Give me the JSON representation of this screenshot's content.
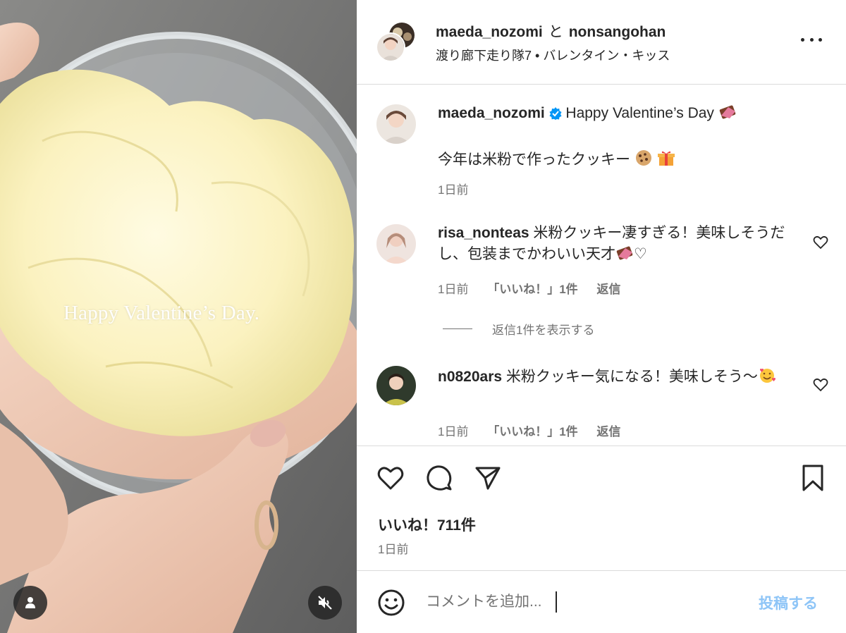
{
  "media": {
    "overlay_text": "Happy Valentine’s Day.",
    "icons": {
      "tags": "person-icon",
      "mute": "speaker-muted-icon"
    }
  },
  "header": {
    "user1": "maeda_nozomi",
    "conjunction": "と",
    "user2": "nonsangohan",
    "subtitle": "渡り廊下走り隊7 • バレンタイン・キッス",
    "more_icon": "ellipsis-icon"
  },
  "caption": {
    "username": "maeda_nozomi",
    "verified_icon": "verified-badge-icon",
    "line1": "Happy Valentine’s Day",
    "line2": "今年は米粉で作ったクッキー",
    "emoji": [
      "chocolate-emoji",
      "cookie-emoji",
      "gift-emoji"
    ],
    "time": "1日前"
  },
  "comments": [
    {
      "username": "risa_nonteas",
      "text": "米粉クッキー凄すぎる！美味しそうだし、包装までかわいい天才",
      "tail": "♡",
      "time": "1日前",
      "likes": "「いいね！」1件",
      "reply": "返信"
    },
    {
      "username": "n0820ars",
      "text": "米粉クッキー気になる！美味しそう〜",
      "time": "1日前",
      "likes": "「いいね！」1件",
      "reply": "返信"
    }
  ],
  "view_replies": "返信1件を表示する",
  "actions": {
    "icons": [
      "heart-icon",
      "comment-icon",
      "share-icon",
      "bookmark-icon"
    ],
    "likes_count": "いいね！711件",
    "time": "1日前"
  },
  "composer": {
    "placeholder": "コメントを追加...",
    "post_label": "投稿する",
    "emoji_icon": "smiley-icon",
    "post_color": "#8ec5f7"
  },
  "colors": {
    "text": "#262626",
    "secondary": "#737373",
    "divider": "#dbdbdb",
    "verified": "#0095f6"
  }
}
